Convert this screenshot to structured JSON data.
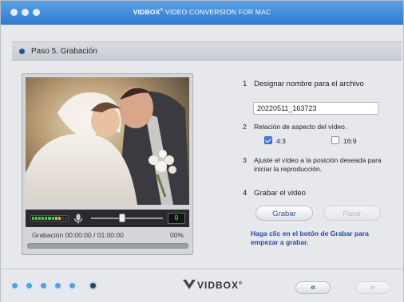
{
  "window": {
    "brand": "VIDBOX",
    "subtitle": "VIDEO CONVERSION FOR MAC"
  },
  "step": {
    "label": "Paso 5. Grabación"
  },
  "preview": {
    "counter": "0",
    "status_time": "Grabación 00:00:00 / 01:00:00",
    "status_percent": "00%",
    "progress": 0
  },
  "steps": {
    "s1_num": "1",
    "s1_label": "Designar nombre para el archivo",
    "filename": "20220511_163723",
    "s2_num": "2",
    "s2_label": "Relación de aspecto del vídeo.",
    "aspect_options": [
      {
        "label": "4:3",
        "checked": true
      },
      {
        "label": "16:9",
        "checked": false
      }
    ],
    "s3_num": "3",
    "s3_line1": "Ajuste el vídeo a la posición deseada para",
    "s3_line2": "iniciar la reproducción.",
    "s4_num": "4",
    "s4_label": "Grabar el video",
    "btn_record": "Grabar",
    "btn_stop": "Parar",
    "hint_line1": "Haga clic en el botón de Grabar para",
    "hint_line2": "empezar a grabar."
  },
  "footer": {
    "logo": "VIDBOX",
    "steps_total": 6,
    "current_step": 6,
    "back": "«",
    "next": "»"
  },
  "colors": {
    "titlebar": "#2f79cf",
    "accent": "#2d57b2",
    "hint": "#2946a2",
    "counter": "#39e24a"
  }
}
